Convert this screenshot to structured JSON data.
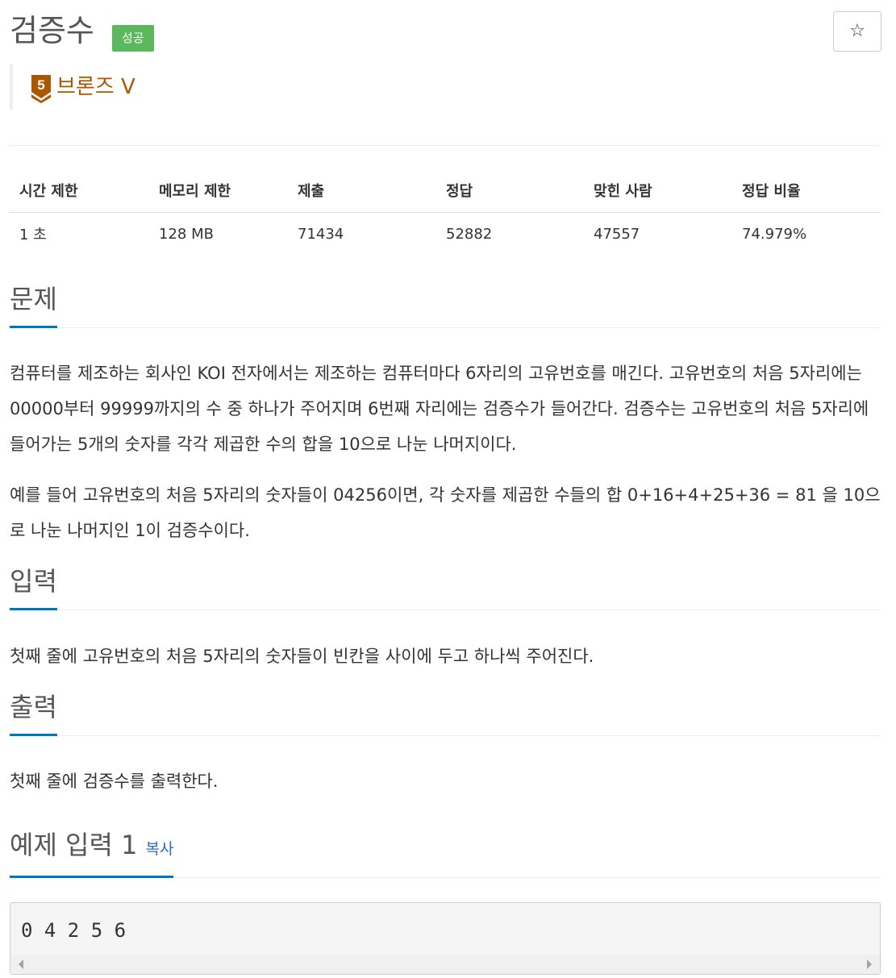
{
  "problem": {
    "title": "검증수",
    "result_badge": "성공",
    "star_icon": "☆",
    "tier": {
      "number": "5",
      "label": "브론즈 V",
      "color": "#ad5600"
    }
  },
  "info_table": {
    "headers": [
      "시간 제한",
      "메모리 제한",
      "제출",
      "정답",
      "맞힌 사람",
      "정답 비율"
    ],
    "values": [
      "1 초",
      "128 MB",
      "71434",
      "52882",
      "47557",
      "74.979%"
    ]
  },
  "sections": {
    "description": {
      "title": "문제",
      "paragraphs": [
        "컴퓨터를 제조하는 회사인 KOI 전자에서는 제조하는 컴퓨터마다 6자리의 고유번호를 매긴다. 고유번호의 처음 5자리에는 00000부터 99999까지의 수 중 하나가 주어지며 6번째 자리에는 검증수가 들어간다. 검증수는 고유번호의 처음 5자리에 들어가는 5개의 숫자를 각각 제곱한 수의 합을 10으로 나눈 나머지이다.",
        "예를 들어 고유번호의 처음 5자리의 숫자들이 04256이면, 각 숫자를 제곱한 수들의 합 0+16+4+25+36 = 81 을 10으로 나눈 나머지인 1이 검증수이다."
      ]
    },
    "input": {
      "title": "입력",
      "text": "첫째 줄에 고유번호의 처음 5자리의 숫자들이 빈칸을 사이에 두고 하나씩 주어진다."
    },
    "output": {
      "title": "출력",
      "text": "첫째 줄에 검증수를 출력한다."
    },
    "sample_input": {
      "title": "예제 입력 1",
      "copy_label": "복사",
      "content": "0 4 2 5 6"
    }
  },
  "colors": {
    "accent": "#0076c0",
    "success": "#5cb85c",
    "link": "#2a6ebb"
  }
}
